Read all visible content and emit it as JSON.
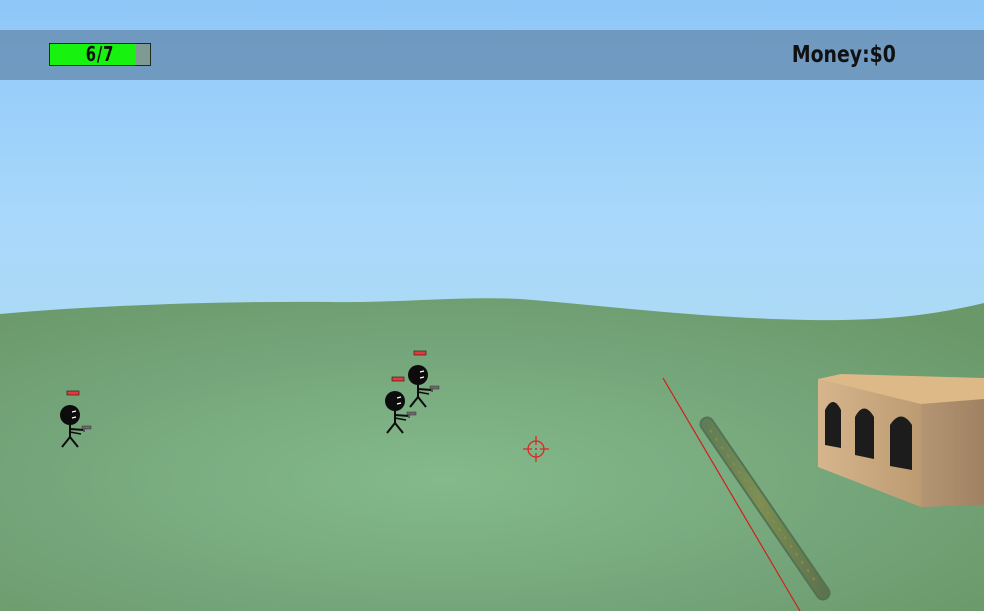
{
  "hud": {
    "health_text": "6/7",
    "health_fraction": 0.857,
    "money_text": "Money:$0"
  },
  "colors": {
    "sky": "#9fd0f6",
    "grass": "#6f9f72",
    "health_fill": "#17f20f",
    "enemy_health": "#e23b3b",
    "crosshair": "#e02020",
    "aim_line": "#cf1f1f",
    "building": "#c8a57a"
  },
  "scene": {
    "enemies": [
      {
        "id": "enemy-1",
        "weapon": "pistol-icon"
      },
      {
        "id": "enemy-2",
        "weapon": "pistol-icon"
      },
      {
        "id": "enemy-3",
        "weapon": "pistol-icon"
      }
    ],
    "crosshair": "crosshair-icon",
    "structure": "arched-building",
    "weapon": "rifle-barrel"
  }
}
